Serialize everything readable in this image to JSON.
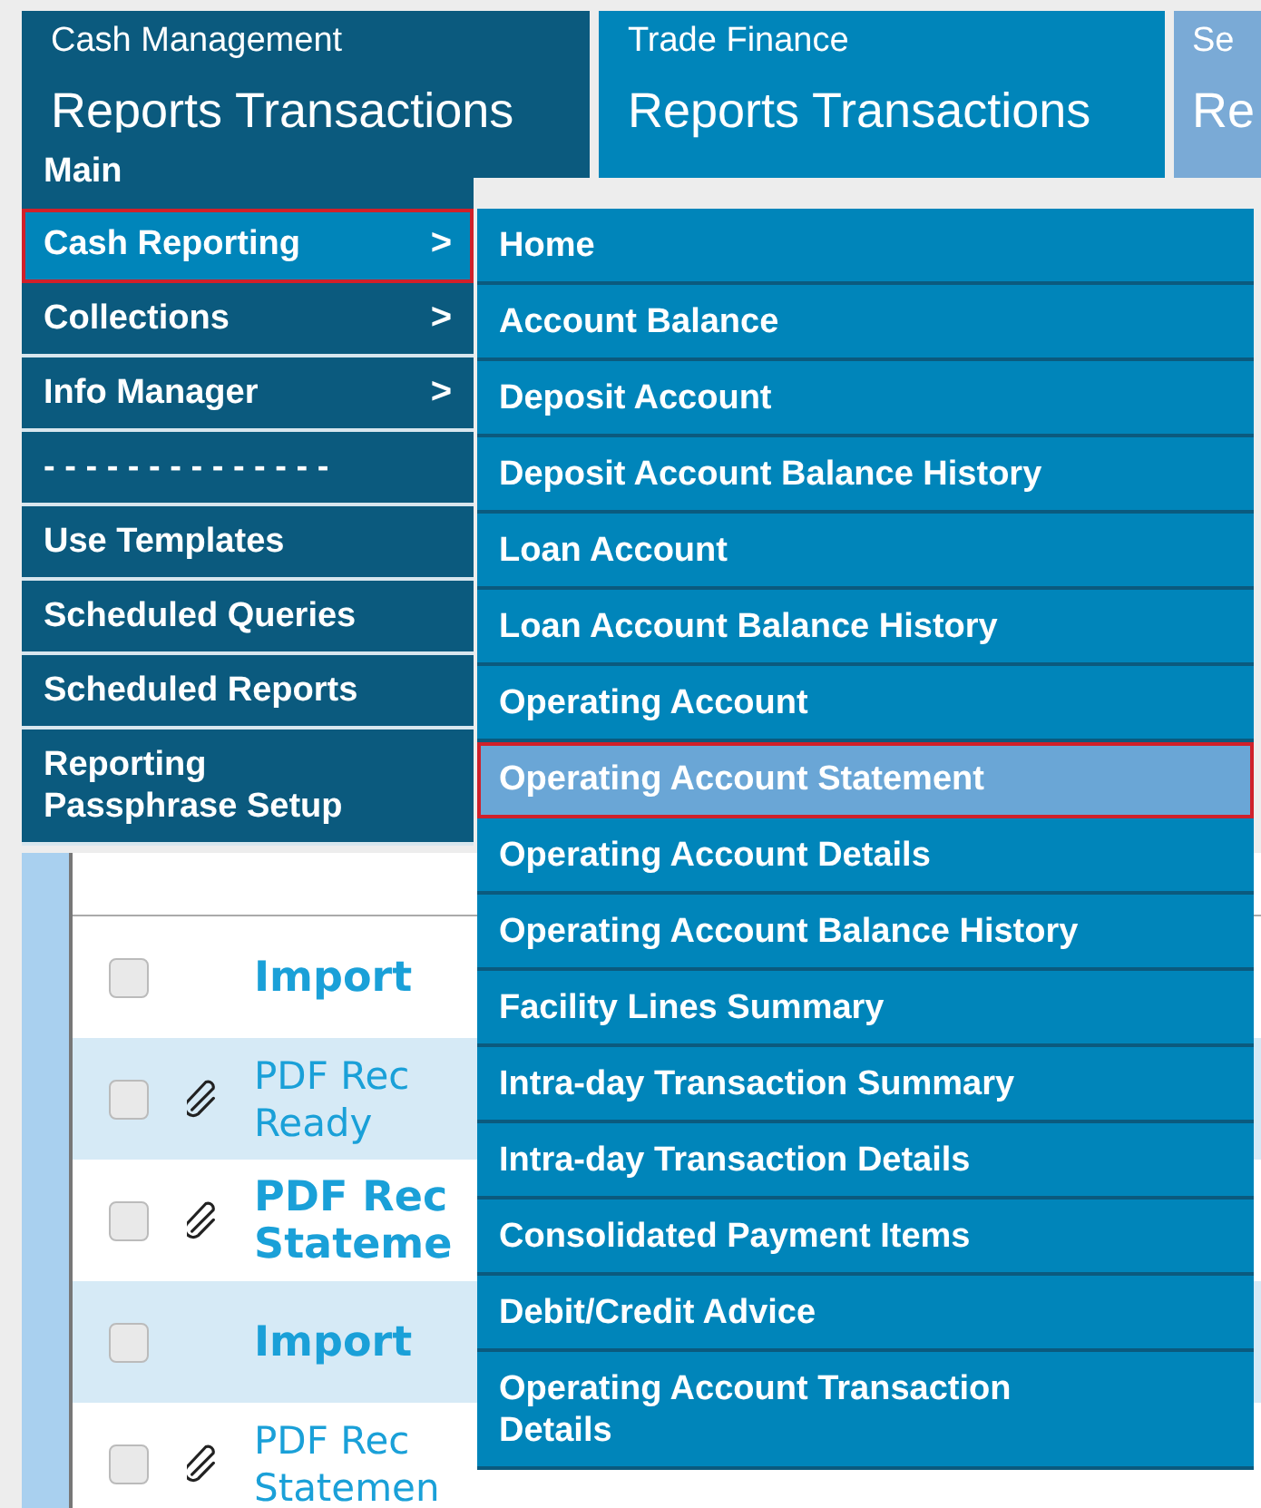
{
  "tabs": [
    {
      "title": "Cash Management",
      "subtitle": "Reports Transactions",
      "selected": true
    },
    {
      "title": "Trade Finance",
      "subtitle": "Reports Transactions",
      "selected": false
    },
    {
      "title": "Se",
      "subtitle": "Re",
      "selected": false,
      "kind": "cut"
    }
  ],
  "menu": {
    "items": [
      {
        "label": "Main",
        "kind": "header",
        "selected": false
      },
      {
        "label": "Cash Reporting",
        "kind": "submenu",
        "arrow": ">",
        "selected": true
      },
      {
        "label": "Collections",
        "kind": "submenu",
        "arrow": ">",
        "selected": false
      },
      {
        "label": "Info Manager",
        "kind": "submenu",
        "arrow": ">",
        "selected": false
      },
      {
        "label": "- - - - - - - - - - - - - -",
        "kind": "separator",
        "selected": false
      },
      {
        "label": "Use Templates",
        "kind": "item",
        "selected": false
      },
      {
        "label": "Scheduled Queries",
        "kind": "item",
        "selected": false
      },
      {
        "label": "Scheduled Reports",
        "kind": "item",
        "selected": false
      },
      {
        "label": "Reporting\nPassphrase Setup",
        "kind": "item",
        "selected": false
      }
    ]
  },
  "submenu": {
    "items": [
      {
        "label": "Home",
        "selected": false
      },
      {
        "label": "Account Balance",
        "selected": false
      },
      {
        "label": "Deposit Account",
        "selected": false
      },
      {
        "label": "Deposit Account Balance History",
        "selected": false
      },
      {
        "label": "Loan Account",
        "selected": false
      },
      {
        "label": "Loan Account Balance History",
        "selected": false
      },
      {
        "label": "Operating Account",
        "selected": false
      },
      {
        "label": "Operating Account Statement",
        "selected": true
      },
      {
        "label": "Operating Account Details",
        "selected": false
      },
      {
        "label": "Operating Account Balance History",
        "selected": false
      },
      {
        "label": "Facility Lines Summary",
        "selected": false
      },
      {
        "label": "Intra-day Transaction Summary",
        "selected": false
      },
      {
        "label": "Intra-day Transaction Details",
        "selected": false
      },
      {
        "label": "Consolidated Payment Items",
        "selected": false
      },
      {
        "label": "Debit/Credit Advice",
        "selected": false
      },
      {
        "label": "Operating Account Transaction\nDetails",
        "selected": false
      }
    ]
  },
  "rows": [
    {
      "lines": [
        "Import"
      ],
      "bold": true,
      "attachment": false,
      "checked": false
    },
    {
      "lines": [
        "PDF Rec",
        "Ready"
      ],
      "bold": false,
      "attachment": true,
      "checked": false
    },
    {
      "lines": [
        "PDF Rec",
        "Stateme"
      ],
      "bold": true,
      "attachment": true,
      "checked": false
    },
    {
      "lines": [
        "Import"
      ],
      "bold": true,
      "attachment": false,
      "checked": false
    },
    {
      "lines": [
        "PDF Rec",
        "Statemen"
      ],
      "bold": false,
      "attachment": true,
      "checked": false
    }
  ]
}
